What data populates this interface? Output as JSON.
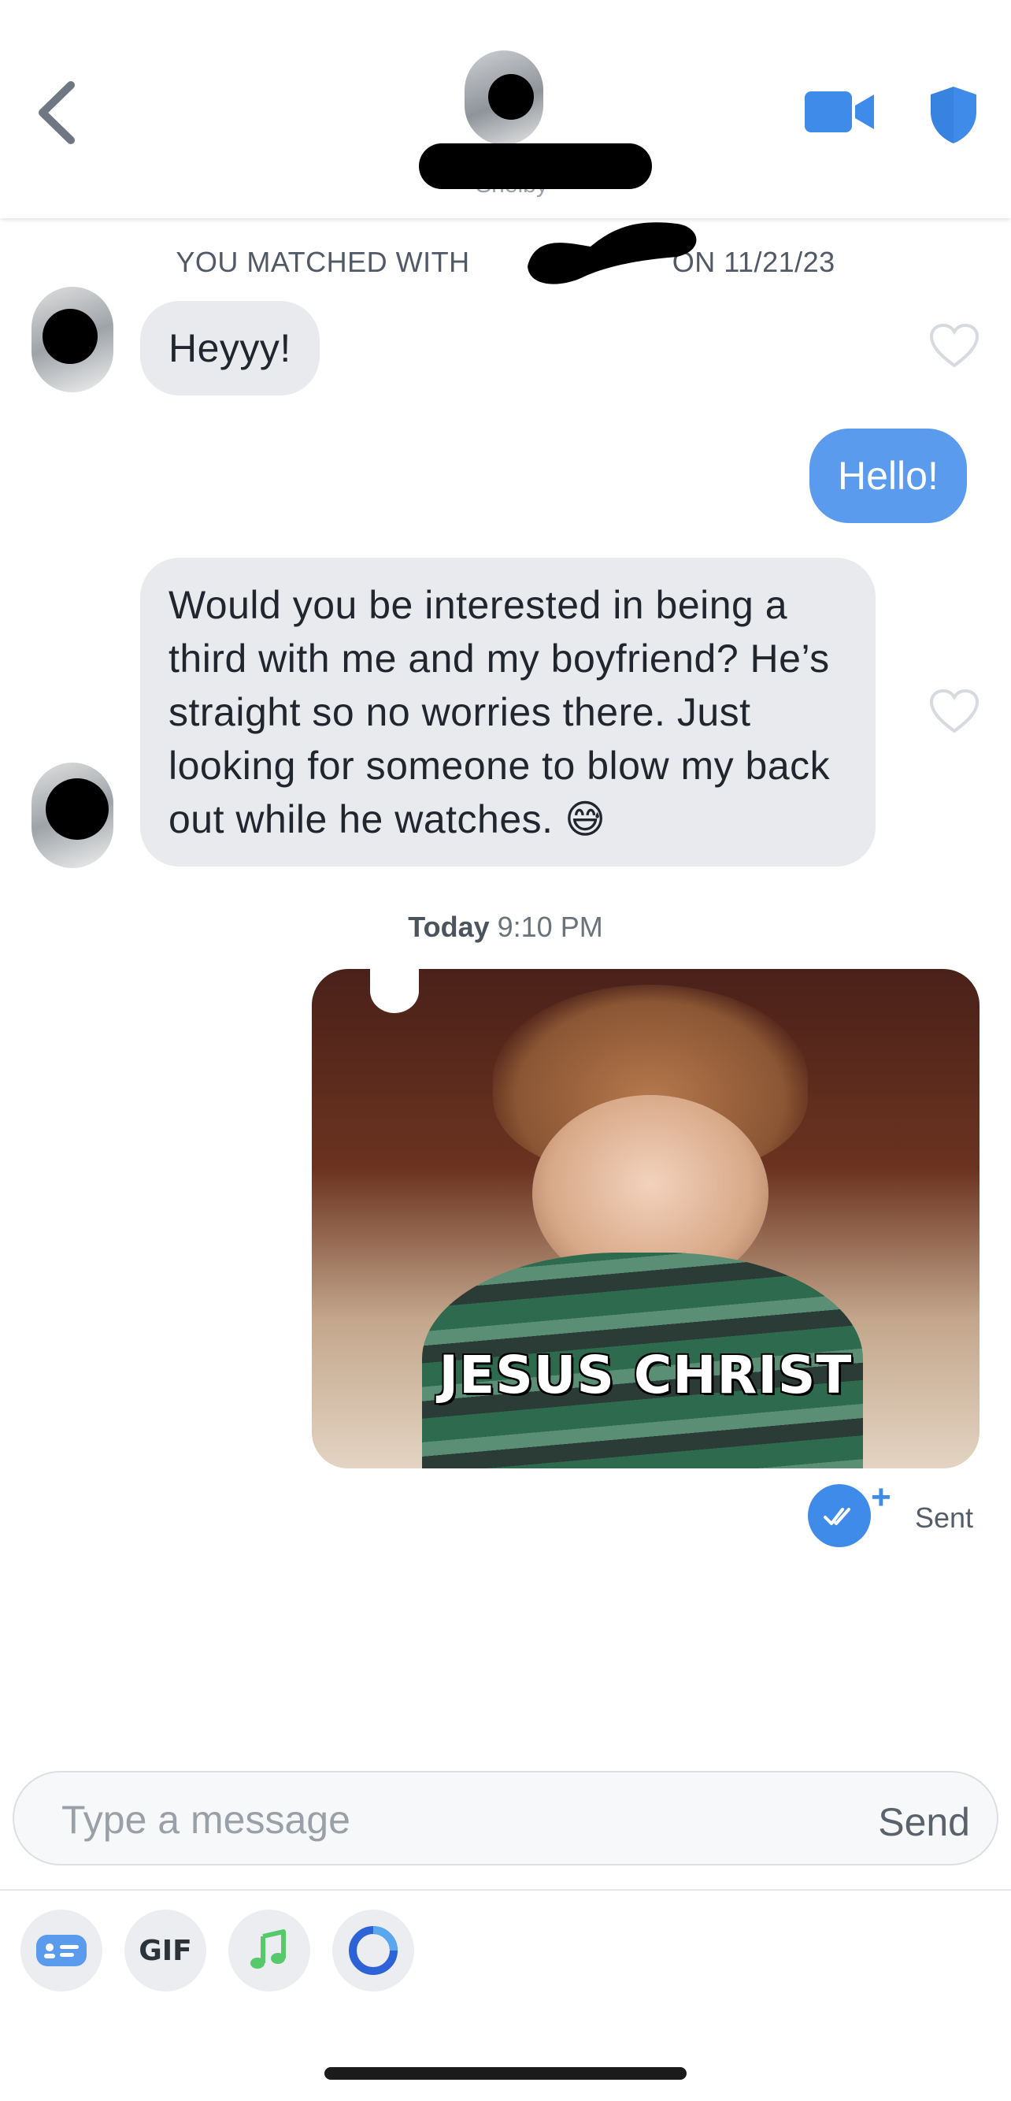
{
  "header": {
    "match_name": "Shelby"
  },
  "match_banner": {
    "prefix": "YOU MATCHED WITH",
    "suffix": "ON 11/21/23"
  },
  "messages": [
    {
      "direction": "received",
      "text": "Heyyy!"
    },
    {
      "direction": "sent",
      "text": "Hello!"
    },
    {
      "direction": "received",
      "text": "Would you be interested in being a third with me and my boyfriend? He’s straight so no worries there. Just looking for someone to blow my back out while he watches. 😅"
    }
  ],
  "timestamp": {
    "day": "Today",
    "time": "9:10 PM"
  },
  "gif_message": {
    "caption": "JESUS CHRIST"
  },
  "status": {
    "label": "Sent"
  },
  "composer": {
    "placeholder": "Type a message",
    "send_label": "Send"
  },
  "toolbar": {
    "gif_label": "GIF"
  },
  "colors": {
    "accent_blue": "#3e8be9",
    "sent_bubble": "#5a9bee",
    "received_bubble": "#e9eaee",
    "music_green": "#56c96b"
  }
}
